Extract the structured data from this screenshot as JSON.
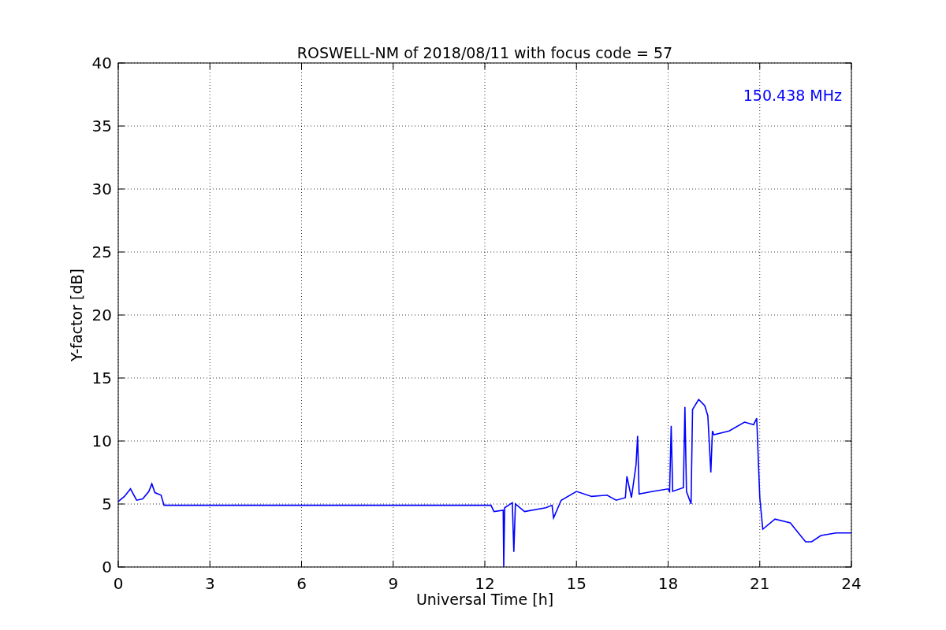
{
  "chart_data": {
    "type": "line",
    "title": "ROSWELL-NM of 2018/08/11 with focus code = 57",
    "xlabel": "Universal Time [h]",
    "ylabel": "Y-factor [dB]",
    "x": [
      0,
      0.2,
      0.4,
      0.6,
      0.8,
      1.0,
      1.1,
      1.2,
      1.4,
      1.45,
      1.5,
      12.2,
      12.3,
      12.6,
      12.62,
      12.65,
      12.9,
      12.95,
      13.0,
      13.3,
      14.0,
      14.2,
      14.25,
      14.5,
      15.0,
      15.5,
      16.0,
      16.3,
      16.6,
      16.65,
      16.8,
      16.95,
      17.0,
      17.05,
      17.5,
      18.0,
      18.05,
      18.1,
      18.15,
      18.5,
      18.55,
      18.6,
      18.75,
      18.8,
      19.0,
      19.2,
      19.3,
      19.4,
      19.45,
      19.5,
      20.0,
      20.5,
      20.8,
      20.9,
      21.0,
      21.1,
      21.5,
      22.0,
      22.5,
      22.7,
      23.0,
      23.5,
      24.0
    ],
    "series": [
      {
        "name": "150.438 MHz",
        "color": "#0000ff",
        "values": [
          5.2,
          5.6,
          6.2,
          5.3,
          5.4,
          6.0,
          6.6,
          5.9,
          5.7,
          5.3,
          4.9,
          4.9,
          4.4,
          4.5,
          0,
          4.7,
          5.1,
          1.2,
          5.0,
          4.4,
          4.7,
          4.9,
          3.9,
          5.3,
          6.0,
          5.6,
          5.7,
          5.3,
          5.5,
          7.2,
          5.5,
          8.1,
          10.4,
          5.8,
          6.0,
          6.2,
          6.0,
          11.2,
          6.0,
          6.3,
          12.7,
          6.0,
          5.0,
          12.5,
          13.3,
          12.8,
          12.0,
          7.5,
          10.8,
          10.5,
          10.8,
          11.5,
          11.3,
          11.8,
          5.5,
          3.0,
          3.8,
          3.5,
          2.0,
          2.0,
          2.5,
          2.7,
          2.7
        ]
      }
    ],
    "xlim": [
      0,
      24
    ],
    "ylim": [
      0,
      40
    ],
    "xticks": [
      0,
      3,
      6,
      9,
      12,
      15,
      18,
      21,
      24
    ],
    "yticks": [
      0,
      5,
      10,
      15,
      20,
      25,
      30,
      35,
      40
    ],
    "grid": true
  }
}
